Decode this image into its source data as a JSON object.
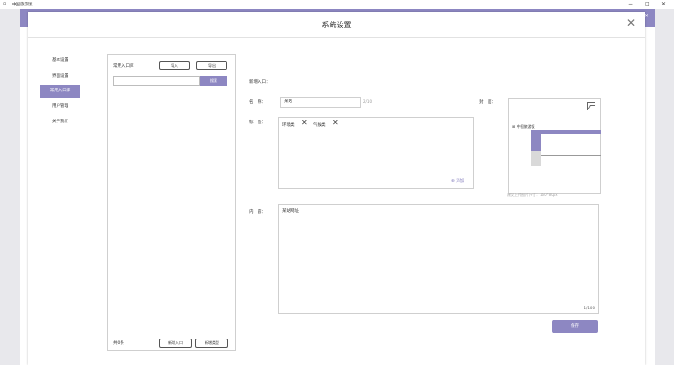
{
  "window": {
    "title": "中国旅游饭",
    "minimize": "−",
    "maximize": "□",
    "close": "✕"
  },
  "background_close": "✕",
  "dialog": {
    "title": "系统设置",
    "close": "✕"
  },
  "nav": {
    "items": [
      {
        "label": "基本设置",
        "active": false
      },
      {
        "label": "界面设置",
        "active": false
      },
      {
        "label": "常用入口库",
        "active": true
      },
      {
        "label": "用户管理",
        "active": false
      },
      {
        "label": "关于我们",
        "active": false
      }
    ]
  },
  "list_panel": {
    "title": "常用入口库",
    "import_label": "导入",
    "export_label": "导出",
    "search_placeholder": "",
    "search_label": "搜索",
    "count_label": "共0条",
    "add_label": "新增入口",
    "new_label": "新增类型"
  },
  "form": {
    "section_label": "新增入口：",
    "name_label": "名　称：",
    "name_value": "某站",
    "name_count": "2/10",
    "tags_label": "标　签：",
    "tags": [
      "环境类",
      "气候类"
    ],
    "tag_remove": "✕",
    "add_tag": "⊕ 添加",
    "cover_label": "封　面：",
    "cover_icon": "image-icon",
    "cover_preview_title": "中国旅游饭",
    "cover_preview_icon": "⊞",
    "cover_hint": "建议上传图片尺寸：160*80px",
    "content_label": "内　容：",
    "content_value": "某站网址",
    "content_count": "1/100",
    "save_label": "保存"
  },
  "colors": {
    "accent": "#8d87c2",
    "border": "#cfcfcf"
  }
}
